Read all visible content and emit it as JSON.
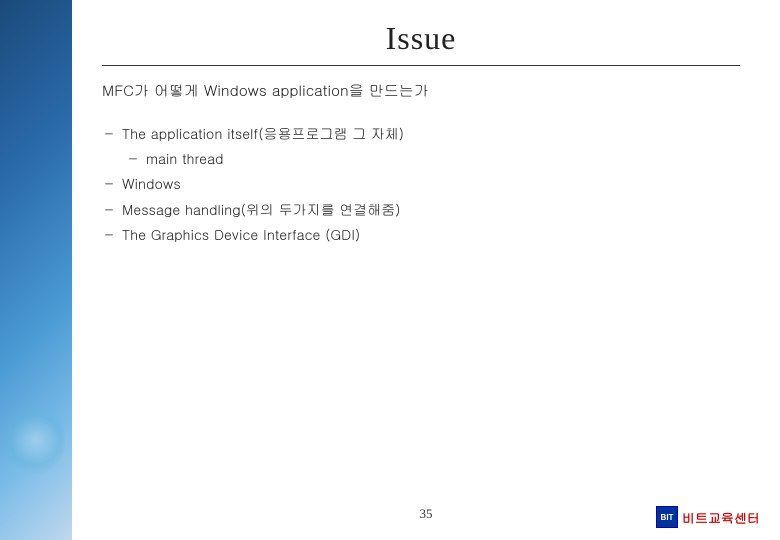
{
  "page": {
    "title": "Issue",
    "subtitle": "MFC가 어떻게 Windows application을 만드는가",
    "items": [
      {
        "text": "The application itself(응용프로그램 그 자체)",
        "subItems": [
          "main thread"
        ]
      },
      {
        "text": "Windows",
        "subItems": []
      },
      {
        "text": "Message handling(위의 두가지를 연결해줌)",
        "subItems": []
      },
      {
        "text": "The Graphics Device Interface (GDI)",
        "subItems": []
      }
    ],
    "pageNumber": "35",
    "branding": {
      "logoText": "비트",
      "label": "비트교육센터"
    }
  }
}
